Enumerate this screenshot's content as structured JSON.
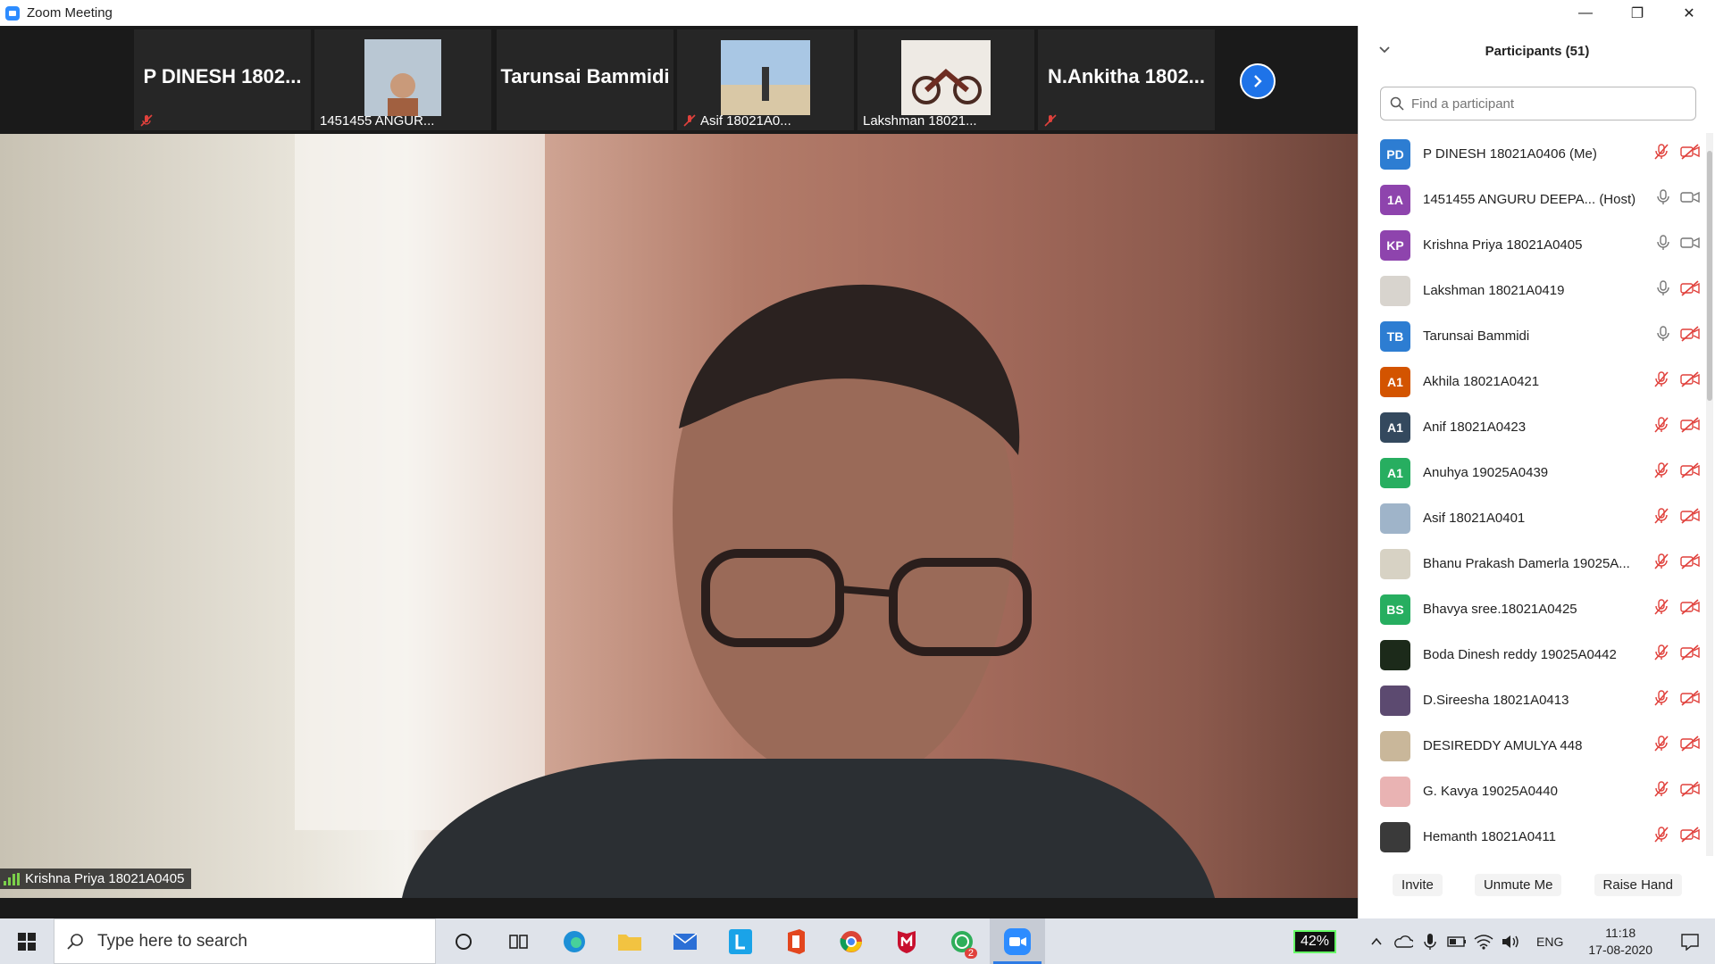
{
  "window": {
    "title": "Zoom Meeting",
    "min": "—",
    "max": "❐",
    "close": "✕"
  },
  "strip": {
    "thumbs": [
      {
        "name": "P DINESH  1802...",
        "caption": ""
      },
      {
        "name": "",
        "caption": "1451455 ANGUR..."
      },
      {
        "name": "Tarunsai Bammidi",
        "caption": ""
      },
      {
        "name": "",
        "caption": "Asif 18021A0..."
      },
      {
        "name": "",
        "caption": "Lakshman 18021..."
      },
      {
        "name": "N.Ankitha  1802...",
        "caption": ""
      }
    ]
  },
  "main": {
    "speaker_label": "Krishna Priya 18021A0405"
  },
  "panel": {
    "title": "Participants (51)",
    "search_placeholder": "Find a participant",
    "participants": [
      {
        "initials": "PD",
        "color": "#2d7dd2",
        "name": "P DINESH 18021A0406 (Me)",
        "mic": "muted",
        "video": "off"
      },
      {
        "initials": "1A",
        "color": "#8e44ad",
        "name": "1451455 ANGURU DEEPA...  (Host)",
        "mic": "on",
        "video": "on"
      },
      {
        "initials": "KP",
        "color": "#8e44ad",
        "name": "Krishna Priya 18021A0405",
        "mic": "on",
        "video": "on"
      },
      {
        "initials": "",
        "color": "#d8d4ce",
        "name": "Lakshman 18021A0419",
        "mic": "on",
        "video": "off"
      },
      {
        "initials": "TB",
        "color": "#2d7dd2",
        "name": "Tarunsai Bammidi",
        "mic": "on",
        "video": "off"
      },
      {
        "initials": "A1",
        "color": "#d35400",
        "name": "Akhila 18021A0421",
        "mic": "muted",
        "video": "off"
      },
      {
        "initials": "A1",
        "color": "#34495e",
        "name": "Anif 18021A0423",
        "mic": "muted",
        "video": "off"
      },
      {
        "initials": "A1",
        "color": "#27ae60",
        "name": "Anuhya 19025A0439",
        "mic": "muted",
        "video": "off"
      },
      {
        "initials": "",
        "color": "#9fb4c9",
        "name": "Asif 18021A0401",
        "mic": "muted",
        "video": "off"
      },
      {
        "initials": "",
        "color": "#d7d2c4",
        "name": "Bhanu Prakash Damerla  19025A...",
        "mic": "muted",
        "video": "off"
      },
      {
        "initials": "BS",
        "color": "#27ae60",
        "name": "Bhavya sree.18021A0425",
        "mic": "muted",
        "video": "off"
      },
      {
        "initials": "",
        "color": "#1c2a1a",
        "name": "Boda Dinesh reddy 19025A0442",
        "mic": "muted",
        "video": "off"
      },
      {
        "initials": "",
        "color": "#5c4a70",
        "name": "D.Sireesha 18021A0413",
        "mic": "muted",
        "video": "off"
      },
      {
        "initials": "",
        "color": "#c9b79a",
        "name": "DESIREDDY AMULYA 448",
        "mic": "muted",
        "video": "off"
      },
      {
        "initials": "",
        "color": "#e9b3b3",
        "name": "G. Kavya 19025A0440",
        "mic": "muted",
        "video": "off"
      },
      {
        "initials": "",
        "color": "#3a3a3a",
        "name": "Hemanth 18021A0411",
        "mic": "muted",
        "video": "off"
      }
    ],
    "buttons": {
      "invite": "Invite",
      "unmute": "Unmute Me",
      "raise_hand": "Raise Hand"
    }
  },
  "taskbar": {
    "search_placeholder": "Type here to search",
    "battery": "42%",
    "lang": "ENG",
    "time": "11:18",
    "date": "17-08-2020",
    "whatsapp_badge": "2"
  },
  "colors": {
    "zoom_blue": "#2d8cff",
    "muted_red": "#e0413c",
    "taskbar": "#dfe3ea"
  }
}
